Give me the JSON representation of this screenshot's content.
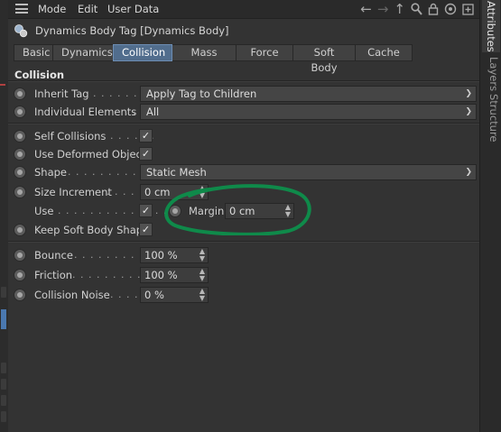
{
  "menubar": {
    "items": [
      "Mode",
      "Edit",
      "User Data"
    ],
    "icons": [
      "back-arrow-icon",
      "forward-arrow-icon",
      "up-arrow-icon",
      "search-icon",
      "lock-icon",
      "target-icon",
      "new-panel-icon"
    ]
  },
  "tag": {
    "title": "Dynamics Body Tag [Dynamics Body]"
  },
  "tabs": [
    "Basic",
    "Dynamics",
    "Collision",
    "Mass",
    "Force",
    "Soft Body",
    "Cache"
  ],
  "active_tab": "Collision",
  "section": {
    "title": "Collision"
  },
  "fields": {
    "inherit_tag": {
      "label": "Inherit Tag",
      "dots": ". . . . . . . .",
      "value": "Apply Tag to Children"
    },
    "individual_elements": {
      "label": "Individual Elements",
      "dots": ". .",
      "value": "All"
    },
    "self_collisions": {
      "label": "Self Collisions",
      "dots": ". . . . . .",
      "check": "✓"
    },
    "use_deformed_object": {
      "label": "Use Deformed Object",
      "check": "✓"
    },
    "shape": {
      "label": "Shape",
      "dots": ". . . . . . . . . . . . .",
      "value": "Static Mesh"
    },
    "size_increment": {
      "label": "Size Increment",
      "dots": ". . . .",
      "value": "0 cm"
    },
    "use": {
      "label": "Use",
      "dots": ". . . . . . . . . . . . . .",
      "check": "✓"
    },
    "margin": {
      "label": "Margin",
      "value": "0 cm"
    },
    "keep_soft_body_shape": {
      "label": "Keep Soft Body Shape",
      "check": "✓"
    },
    "bounce": {
      "label": "Bounce",
      "dots": ". . . . . . . . . . .",
      "value": "100 %"
    },
    "friction": {
      "label": "Friction",
      "dots": ". . . . . . . . . . .",
      "value": "100 %"
    },
    "collision_noise": {
      "label": "Collision Noise",
      "dots": ". . . .",
      "value": "0 %"
    }
  },
  "right_rail": [
    "Attributes",
    "Layers",
    "Structure"
  ],
  "colors": {
    "panel_bg": "#333333",
    "active_tab": "#516d8d",
    "annotation": "#0f8a4a"
  }
}
